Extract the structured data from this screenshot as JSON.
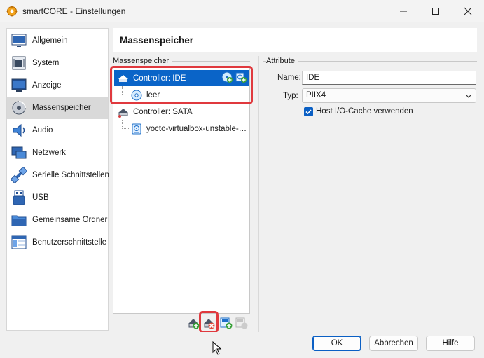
{
  "window": {
    "title": "smartCORE - Einstellungen",
    "icon": "virtualbox-gear-icon"
  },
  "sidebar": {
    "items": [
      {
        "label": "Allgemein",
        "icon": "general-icon"
      },
      {
        "label": "System",
        "icon": "system-chip-icon"
      },
      {
        "label": "Anzeige",
        "icon": "display-icon"
      },
      {
        "label": "Massenspeicher",
        "icon": "storage-disk-icon",
        "selected": true
      },
      {
        "label": "Audio",
        "icon": "speaker-icon"
      },
      {
        "label": "Netzwerk",
        "icon": "network-icon"
      },
      {
        "label": "Serielle Schnittstellen",
        "icon": "serial-port-icon"
      },
      {
        "label": "USB",
        "icon": "usb-icon"
      },
      {
        "label": "Gemeinsame Ordner",
        "icon": "shared-folder-icon"
      },
      {
        "label": "Benutzerschnittstelle",
        "icon": "user-interface-icon"
      }
    ]
  },
  "page": {
    "heading": "Massenspeicher"
  },
  "storage": {
    "group_label": "Massenspeicher",
    "tree": [
      {
        "label": "Controller: IDE",
        "type": "controller",
        "selected": true
      },
      {
        "label": "leer",
        "type": "optical"
      },
      {
        "label": "Controller: SATA",
        "type": "controller"
      },
      {
        "label": "yocto-virtualbox-unstable-h...",
        "type": "disk"
      }
    ],
    "toolbar": [
      "add-controller-icon",
      "remove-controller-icon",
      "add-attachment-icon",
      "remove-attachment-icon"
    ]
  },
  "attributes": {
    "group_label": "Attribute",
    "name_label": "Name:",
    "name_value": "IDE",
    "type_label": "Typ:",
    "type_value": "PIIX4",
    "cache_label": "Host I/O-Cache verwenden",
    "cache_checked": true
  },
  "buttons": {
    "ok": "OK",
    "cancel": "Abbrechen",
    "help": "Hilfe"
  },
  "colors": {
    "selection": "#0a64c8",
    "highlight_box": "#e0393e",
    "accent": "#0a5fc4"
  }
}
